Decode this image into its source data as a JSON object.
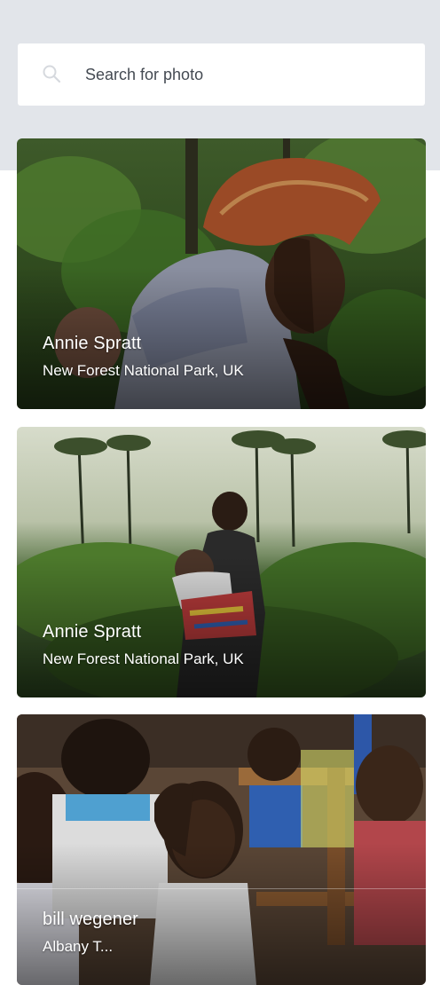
{
  "search": {
    "placeholder": "Search for photo",
    "icon": "search-icon"
  },
  "photos": [
    {
      "author": "Annie Spratt",
      "location": "New Forest National Park, UK"
    },
    {
      "author": "Annie Spratt",
      "location": "New Forest National Park, UK"
    },
    {
      "author": "bill wegener",
      "location": "Albany T..."
    }
  ],
  "colors": {
    "header_background": "#e2e5ea",
    "card_text": "#ffffff",
    "placeholder_text": "#444a52"
  }
}
